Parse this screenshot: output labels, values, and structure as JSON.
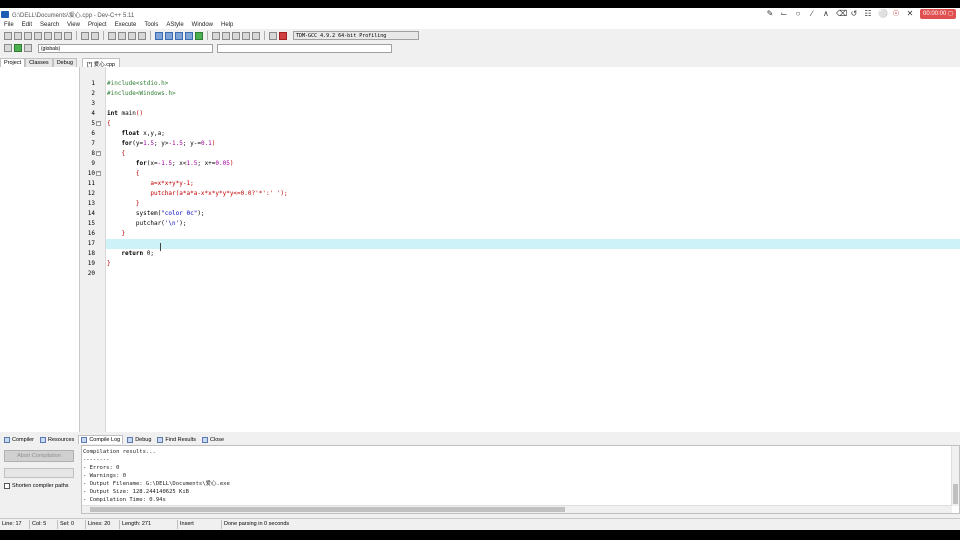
{
  "window": {
    "title": "G:\\DELL\\Documents\\爱心.cpp - Dev-C++ 5.11"
  },
  "recorder": {
    "timer": "00:00:00 ◻",
    "tools": [
      "pen-icon",
      "corner-icon",
      "circle-icon",
      "line-icon",
      "poly-icon",
      "eraser-icon",
      "undo-icon",
      "trash-icon",
      "mic-off-icon",
      "camera-off-icon",
      "close-icon"
    ]
  },
  "menu": [
    "File",
    "Edit",
    "Search",
    "View",
    "Project",
    "Execute",
    "Tools",
    "AStyle",
    "Window",
    "Help"
  ],
  "toolbar": {
    "compiler": "TDM-GCC 4.9.2 64-bit Profiling"
  },
  "toolbar2": {
    "scope": "(globals)"
  },
  "left_tabs": [
    "Project",
    "Classes",
    "Debug"
  ],
  "editor_tab": "[*] 爱心.cpp",
  "code": {
    "line_numbers": [
      "1",
      "2",
      "3",
      "4",
      "5",
      "6",
      "7",
      "8",
      "9",
      "10",
      "11",
      "12",
      "13",
      "14",
      "15",
      "16",
      "17",
      "18",
      "19",
      "20"
    ],
    "lines": [
      [
        {
          "t": "#include<stdio.h>",
          "c": "pp"
        }
      ],
      [
        {
          "t": "#include<Windows.h>",
          "c": "pp"
        }
      ],
      [],
      [
        {
          "t": "int",
          "c": "kw"
        },
        {
          "t": " main",
          "c": ""
        },
        {
          "t": "()",
          "c": "op"
        }
      ],
      [
        {
          "t": "{",
          "c": "op"
        }
      ],
      [
        {
          "t": "    float",
          "c": "kw"
        },
        {
          "t": " x,y,a;",
          "c": ""
        }
      ],
      [
        {
          "t": "    for",
          "c": "kw"
        },
        {
          "t": "(y=",
          "c": ""
        },
        {
          "t": "1.5",
          "c": "num"
        },
        {
          "t": "; y>",
          "c": ""
        },
        {
          "t": "-1.5",
          "c": "num"
        },
        {
          "t": "; y-=",
          "c": ""
        },
        {
          "t": "0.1",
          "c": "num"
        },
        {
          "t": ")",
          "c": "op"
        }
      ],
      [
        {
          "t": "    {",
          "c": "op"
        }
      ],
      [
        {
          "t": "        for",
          "c": "kw"
        },
        {
          "t": "(x=",
          "c": ""
        },
        {
          "t": "-1.5",
          "c": "num"
        },
        {
          "t": "; x<",
          "c": ""
        },
        {
          "t": "1.5",
          "c": "num"
        },
        {
          "t": "; x+=",
          "c": ""
        },
        {
          "t": "0.05",
          "c": "num"
        },
        {
          "t": ")",
          "c": "op"
        }
      ],
      [
        {
          "t": "        {",
          "c": "op"
        }
      ],
      [
        {
          "t": "            a=x*x+y*y-1;",
          "c": "op"
        }
      ],
      [
        {
          "t": "            putchar(a*a*a-x*x*y*y*y<=0.0?'*':' ');",
          "c": "op"
        }
      ],
      [
        {
          "t": "        }",
          "c": "op"
        }
      ],
      [
        {
          "t": "        system(",
          "c": ""
        },
        {
          "t": "\"color 0c\"",
          "c": "str"
        },
        {
          "t": ");",
          "c": ""
        }
      ],
      [
        {
          "t": "        putchar(",
          "c": ""
        },
        {
          "t": "'\\n'",
          "c": "str"
        },
        {
          "t": ");",
          "c": ""
        }
      ],
      [
        {
          "t": "    }",
          "c": "op"
        }
      ],
      [],
      [
        {
          "t": "    return",
          "c": "kw"
        },
        {
          "t": " 0;",
          "c": ""
        }
      ],
      [
        {
          "t": "}",
          "c": "op"
        }
      ],
      []
    ]
  },
  "bottom_tabs": [
    "Compiler",
    "Resources",
    "Compile Log",
    "Debug",
    "Find Results",
    "Close"
  ],
  "abort_label": "Abort Compilation",
  "shorten_label": "Shorten compiler paths",
  "log": [
    "Compilation results...",
    "--------",
    "- Errors: 0",
    "- Warnings: 0",
    "- Output Filename: G:\\DELL\\Documents\\爱心.exe",
    "- Output Size: 128.244140625 KiB",
    "- Compilation Time: 0.94s"
  ],
  "status": {
    "line": "Line:   17",
    "col": "Col:    5",
    "sel": "Sel:    0",
    "lines": "Lines:   20",
    "length": "Length:   271",
    "mode": "Insert",
    "message": "Done parsing in 0 seconds"
  }
}
